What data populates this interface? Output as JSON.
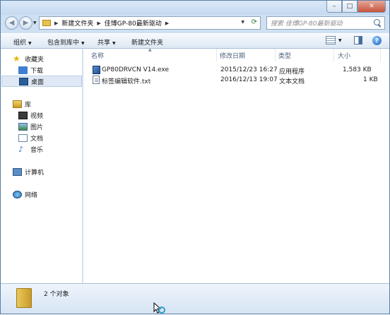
{
  "window": {
    "min_label": "–",
    "max_label": "□",
    "close_label": "✕"
  },
  "address": {
    "crumbs": [
      "新建文件夹",
      "佳博GP-80最新驱动"
    ]
  },
  "search": {
    "placeholder": "搜索 佳博GP-80最新驱动"
  },
  "toolbar": {
    "organize": "组织",
    "include_in_library": "包含到库中",
    "share": "共享",
    "new_folder": "新建文件夹"
  },
  "sidebar": {
    "favorites": "收藏夹",
    "downloads": "下载",
    "desktop": "桌面",
    "libraries": "库",
    "videos": "视频",
    "pictures": "图片",
    "documents": "文档",
    "music": "音乐",
    "computer": "计算机",
    "network": "网络"
  },
  "columns": {
    "name": "名称",
    "modified": "修改日期",
    "type": "类型",
    "size": "大小"
  },
  "files": [
    {
      "name": "GP80DRVCN V14.exe",
      "modified": "2015/12/23 16:27",
      "type": "应用程序",
      "size": "1,583 KB",
      "icon": "exe-icon"
    },
    {
      "name": "标签编辑软件.txt",
      "modified": "2016/12/13 19:07",
      "type": "文本文档",
      "size": "1 KB",
      "icon": "txt-icon"
    }
  ],
  "status": {
    "count_text": "2 个对象"
  }
}
